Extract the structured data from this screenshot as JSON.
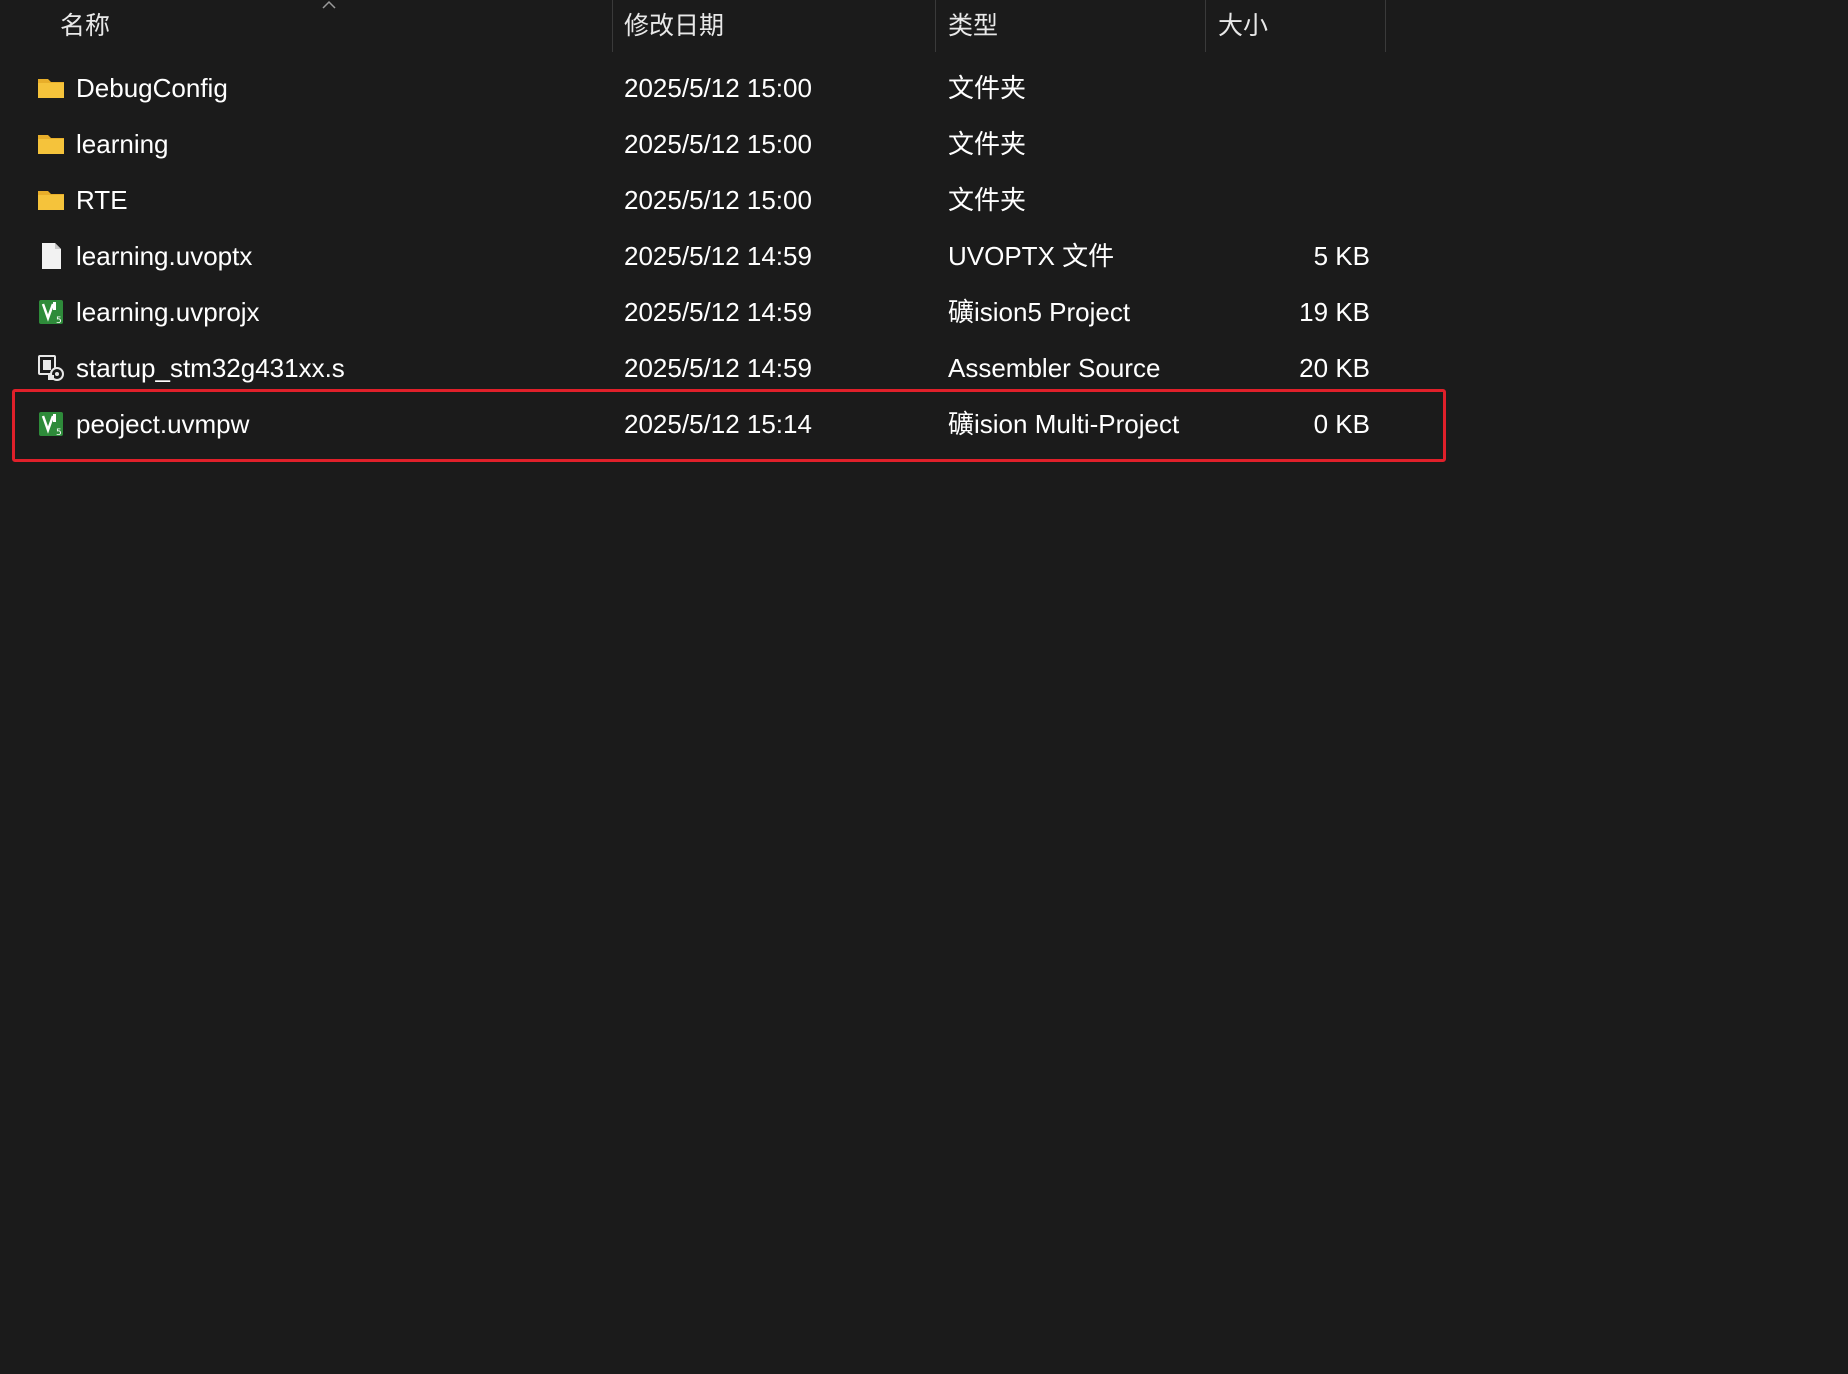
{
  "header": {
    "name_label": "名称",
    "date_label": "修改日期",
    "type_label": "类型",
    "size_label": "大小"
  },
  "files": [
    {
      "name": "DebugConfig",
      "date": "2025/5/12 15:00",
      "type": "文件夹",
      "size": "",
      "icon": "folder-icon"
    },
    {
      "name": "learning",
      "date": "2025/5/12 15:00",
      "type": "文件夹",
      "size": "",
      "icon": "folder-icon"
    },
    {
      "name": "RTE",
      "date": "2025/5/12 15:00",
      "type": "文件夹",
      "size": "",
      "icon": "folder-icon"
    },
    {
      "name": "learning.uvoptx",
      "date": "2025/5/12 14:59",
      "type": "UVOPTX 文件",
      "size": "5 KB",
      "icon": "blank-file-icon"
    },
    {
      "name": "learning.uvprojx",
      "date": "2025/5/12 14:59",
      "type": "礦ision5 Project",
      "size": "19 KB",
      "icon": "keil-uvision-icon"
    },
    {
      "name": "startup_stm32g431xx.s",
      "date": "2025/5/12 14:59",
      "type": "Assembler Source",
      "size": "20 KB",
      "icon": "assembler-source-icon"
    },
    {
      "name": "peoject.uvmpw",
      "date": "2025/5/12 15:14",
      "type": "礦ision Multi-Project",
      "size": "0 KB",
      "icon": "keil-uvision-icon"
    }
  ],
  "highlight_color": "#e0202a",
  "folder_color": "#f5c33b"
}
